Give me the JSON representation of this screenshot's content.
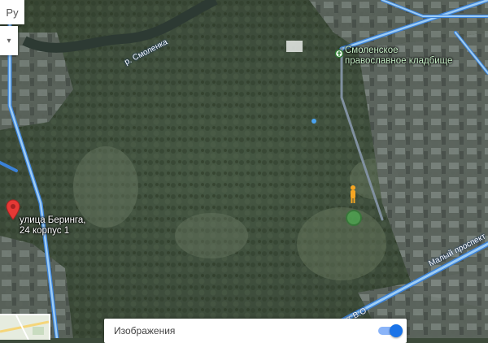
{
  "map": {
    "river_label": "р. Смоленка",
    "cemetery_label_line1": "Смоленское",
    "cemetery_label_line2": "православное кладбище",
    "address_line1": "улица Беринга,",
    "address_line2": "24 корпус 1",
    "road_label_maly": "Малый проспект",
    "road_label_vo": "роспект В.О"
  },
  "controls": {
    "language_button": "Ру",
    "menu_glyph": "▾",
    "imagery_label": "Изображения",
    "imagery_toggle_on": true
  },
  "colors": {
    "road_outline": "#3b82d8",
    "road_fill": "#9ecdf5",
    "pin_red": "#e53935",
    "toggle_blue": "#1a73e8",
    "pegman_orange": "#f5a623",
    "cemetery_pin_green": "#2e7d32"
  },
  "icons": [
    "apps-grid-icon",
    "account-icon",
    "map-pin-icon",
    "pegman-icon",
    "cemetery-place-icon",
    "dropdown-arrow-icon"
  ]
}
